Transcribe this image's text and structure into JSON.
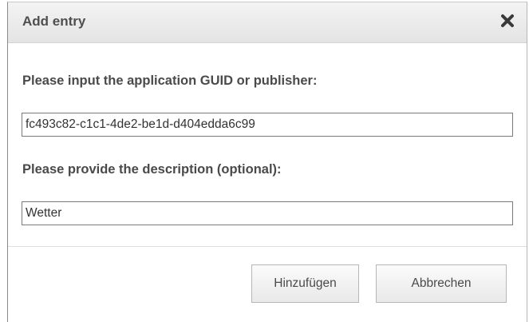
{
  "dialog": {
    "title": "Add entry",
    "close_icon": "close-x-icon"
  },
  "form": {
    "guid_label": "Please input the application GUID or publisher:",
    "guid_value": "fc493c82-c1c1-4de2-be1d-d404edda6c99",
    "description_label": "Please provide the description (optional):",
    "description_value": "Wetter"
  },
  "buttons": {
    "add_label": "Hinzufügen",
    "cancel_label": "Abbrechen"
  },
  "colors": {
    "titlebar": "#e9e9e9",
    "title_text": "#4f4f4f",
    "field_border": "#7a7a7a"
  }
}
